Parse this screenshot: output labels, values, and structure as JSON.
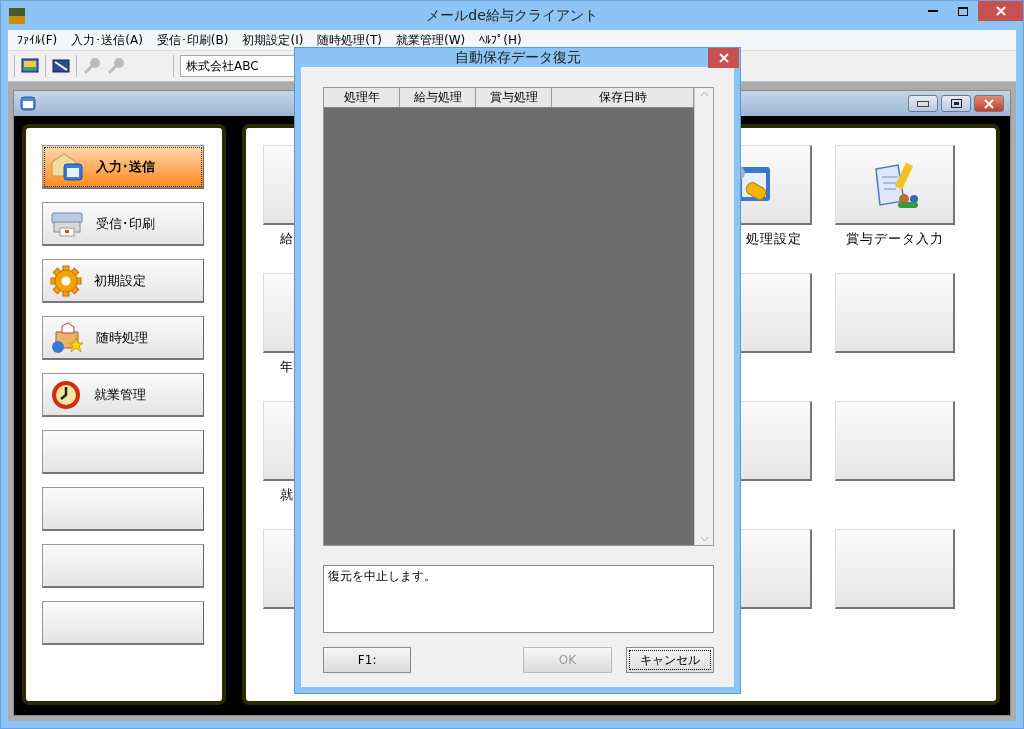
{
  "window": {
    "title": "メールde給与クライアント"
  },
  "menu": [
    "ﾌｧｲﾙ(F)",
    "入力･送信(A)",
    "受信･印刷(B)",
    "初期設定(I)",
    "随時処理(T)",
    "就業管理(W)",
    "ﾍﾙﾌﾟ(H)"
  ],
  "toolbar": {
    "company": "株式会社ABC"
  },
  "sidebar": [
    {
      "kind": "labeled",
      "label": "入力･送信",
      "selected": true
    },
    {
      "kind": "labeled",
      "label": "受信･印刷",
      "selected": false
    },
    {
      "kind": "labeled",
      "label": "初期設定",
      "selected": false
    },
    {
      "kind": "labeled",
      "label": "随時処理",
      "selected": false
    },
    {
      "kind": "labeled",
      "label": "就業管理",
      "selected": false
    },
    {
      "kind": "blank",
      "selected": false
    },
    {
      "kind": "blank",
      "selected": false
    },
    {
      "kind": "blank",
      "selected": false
    },
    {
      "kind": "blank",
      "selected": false
    }
  ],
  "tile_columns": [
    {
      "tiles": [
        {
          "kind": "labeled",
          "label": "給"
        },
        {
          "kind": "labeled",
          "label": "年"
        },
        {
          "kind": "labeled",
          "label": "就"
        },
        {
          "kind": "blank"
        }
      ]
    },
    {
      "tiles": [
        {
          "kind": "labeled",
          "label": "処理設定"
        },
        {
          "kind": "blank"
        },
        {
          "kind": "blank"
        },
        {
          "kind": "blank"
        }
      ]
    },
    {
      "tiles": [
        {
          "kind": "labeled",
          "label": "賞与データ入力"
        },
        {
          "kind": "blank"
        },
        {
          "kind": "blank"
        },
        {
          "kind": "blank"
        }
      ]
    }
  ],
  "dialog": {
    "title": "自動保存データ復元",
    "table": {
      "columns": [
        "処理年",
        "給与処理",
        "賞与処理",
        "保存日時"
      ]
    },
    "message": "復元を中止します。",
    "buttons": [
      {
        "label": "F1:",
        "disabled": false,
        "focused": false
      },
      {
        "label": "OK",
        "disabled": true,
        "focused": false
      },
      {
        "label": "キャンセル",
        "disabled": false,
        "focused": true
      }
    ]
  }
}
